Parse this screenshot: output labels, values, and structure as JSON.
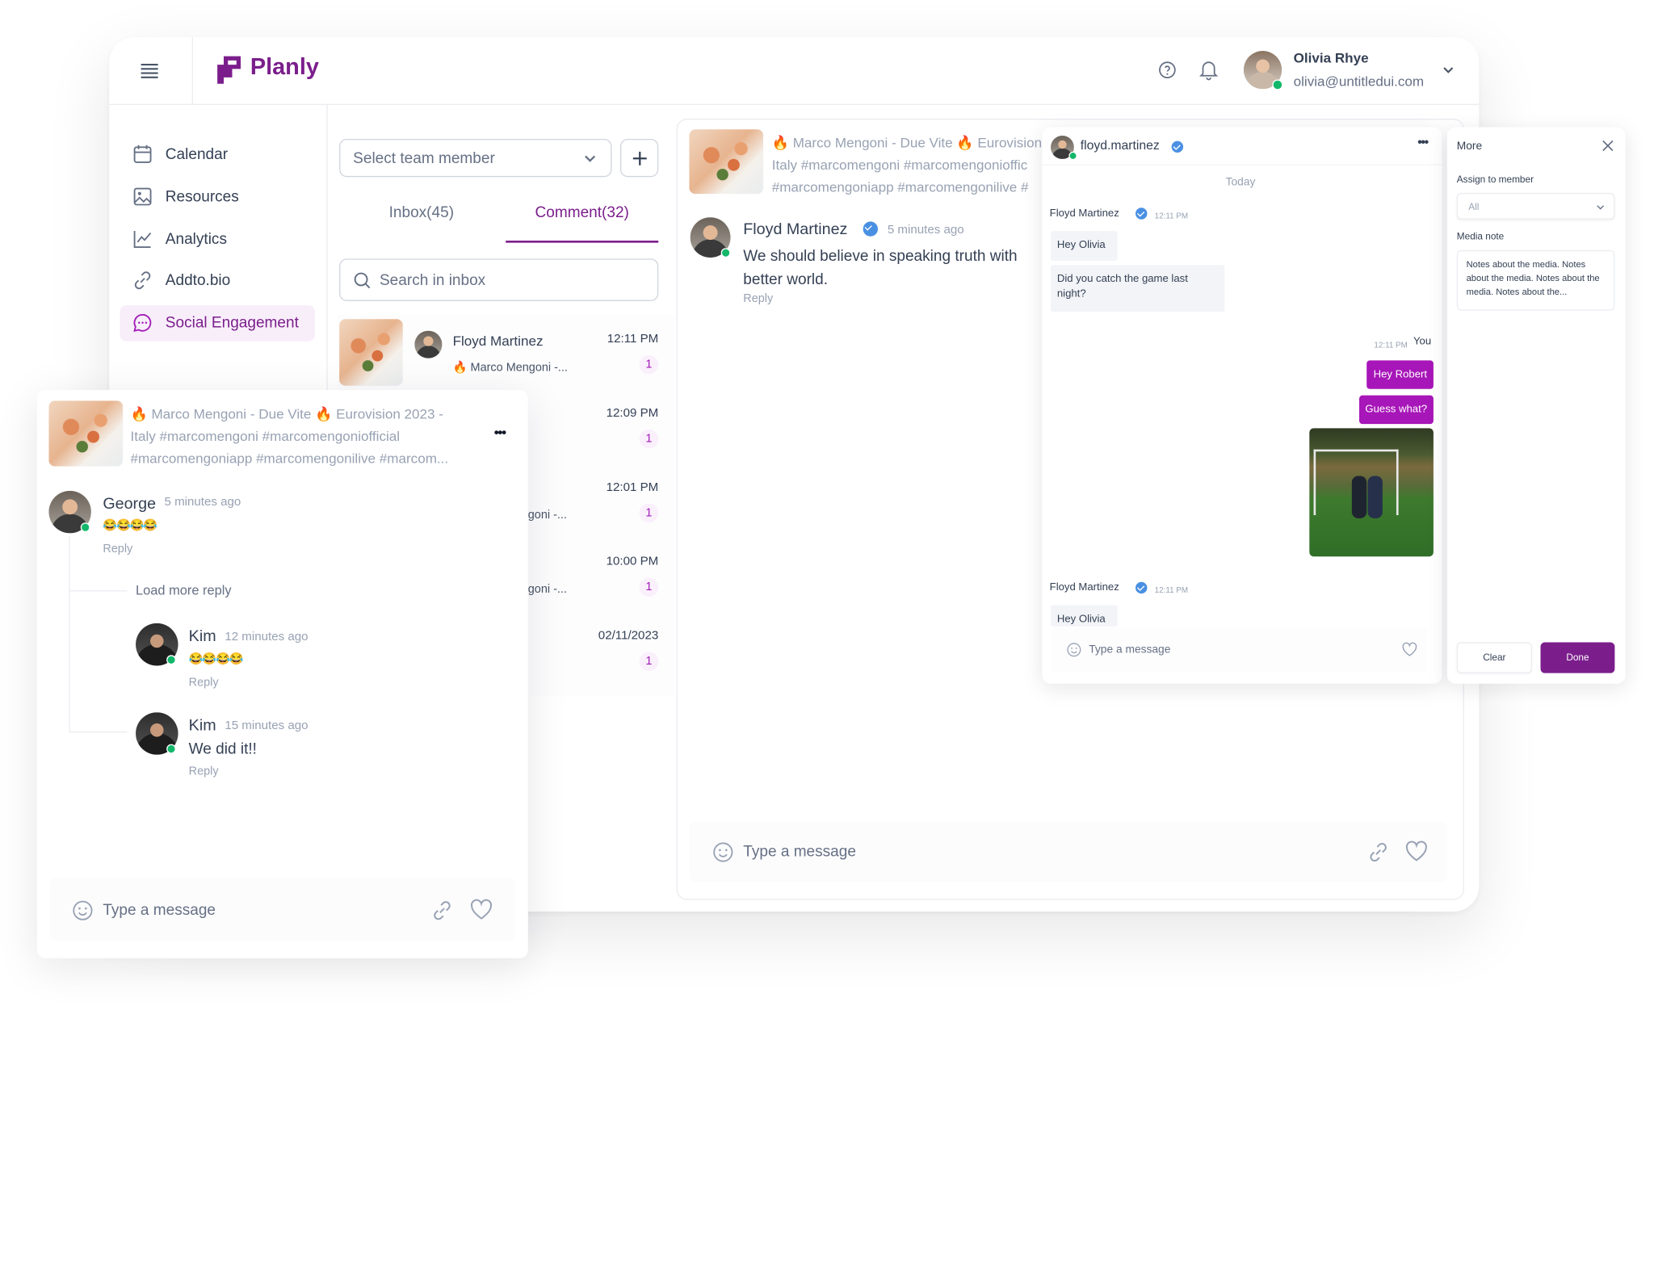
{
  "brand": {
    "name": "Planly",
    "accent": "#7b1e8c",
    "bubble": "#a716b8"
  },
  "header": {
    "user_name": "Olivia Rhye",
    "user_email": "olivia@untitledui.com"
  },
  "sidebar": {
    "items": [
      {
        "label": "Calendar",
        "icon": "calendar-icon"
      },
      {
        "label": "Resources",
        "icon": "image-icon"
      },
      {
        "label": "Analytics",
        "icon": "chart-icon"
      },
      {
        "label": "Addto.bio",
        "icon": "link-icon"
      },
      {
        "label": "Social Engagement",
        "icon": "chat-icon",
        "active": true
      }
    ]
  },
  "inbox": {
    "select_placeholder": "Select team member",
    "tabs": [
      {
        "label": "Inbox(45)"
      },
      {
        "label": "Comment(32)",
        "active": true
      }
    ],
    "search_placeholder": "Search in inbox",
    "rows": [
      {
        "name": "Floyd Martinez",
        "preview": "🔥 Marco Mengoni -...",
        "time": "12:11 PM",
        "count": "1"
      },
      {
        "time": "12:09 PM",
        "count": "1"
      },
      {
        "preview": "goni -...",
        "time": "12:01 PM",
        "count": "1"
      },
      {
        "preview": "goni -...",
        "time": "10:00 PM",
        "count": "1"
      },
      {
        "time": "02/11/2023",
        "count": "1"
      }
    ]
  },
  "post": {
    "line1": "🔥 Marco Mengoni - Due Vite 🔥 Eurovision",
    "line2": "Italy #marcomengoni #marcomengonioffic",
    "line3": "#marcomengoniapp #marcomengonilive #"
  },
  "comment": {
    "name": "Floyd Martinez",
    "time": "5 minutes ago",
    "text1": "We should believe in speaking truth with",
    "text2": "better world.",
    "reply": "Reply"
  },
  "main_input": {
    "placeholder": "Type a message"
  },
  "chat": {
    "username": "floyd.martinez",
    "day": "Today",
    "sender": "Floyd Martinez",
    "time": "12:11 PM",
    "msg1": "Hey Olivia",
    "msg2": "Did you catch the game last night?",
    "me_label": "You",
    "me_time": "12:11 PM",
    "me1": "Hey Robert",
    "me2": "Guess what?",
    "sender2": "Floyd Martinez",
    "time2": "12:11 PM",
    "msg3": "Hey Olivia",
    "input_placeholder": "Type a message"
  },
  "more": {
    "title": "More",
    "assign_label": "Assign to member",
    "assign_value": "All",
    "note_label": "Media note",
    "note_text": "Notes about the media. Notes about the media. Notes about the media. Notes about the...",
    "clear": "Clear",
    "done": "Done"
  },
  "float": {
    "line1": "🔥 Marco Mengoni - Due Vite 🔥 Eurovision 2023 -",
    "line2": "Italy #marcomengoni #marcomengoniofficial",
    "line3": "#marcomengoniapp #marcomengonilive #marcom...",
    "george": {
      "name": "George",
      "time": "5 minutes ago",
      "text": "😂😂😂😂",
      "reply": "Reply"
    },
    "load_more": "Load more reply",
    "kim1": {
      "name": "Kim",
      "time": "12 minutes ago",
      "text": "😂😂😂😂",
      "reply": "Reply"
    },
    "kim2": {
      "name": "Kim",
      "time": "15 minutes ago",
      "text": "We did it!!",
      "reply": "Reply"
    },
    "input_placeholder": "Type a message"
  }
}
